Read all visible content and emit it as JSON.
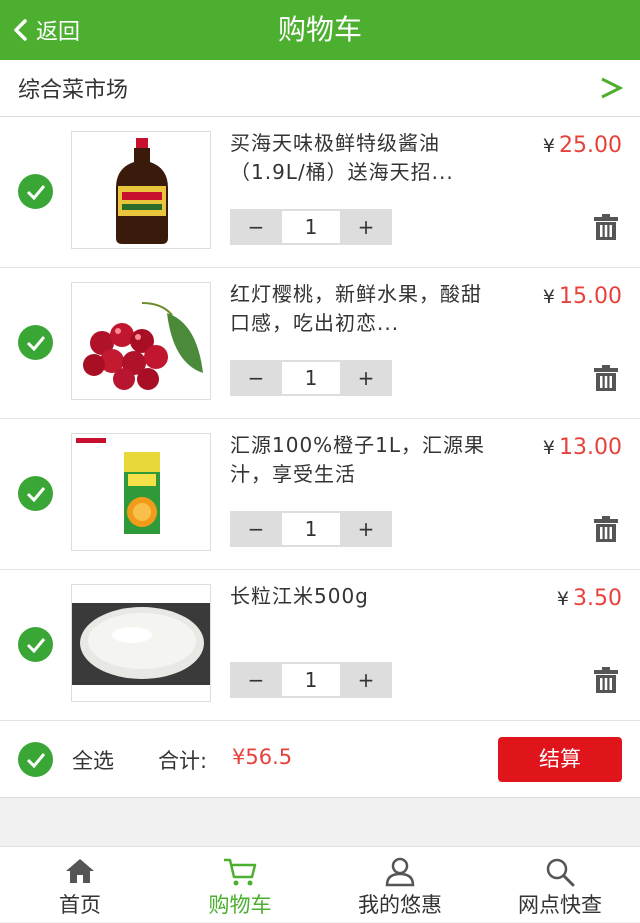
{
  "header": {
    "back_label": "返回",
    "title": "购物车"
  },
  "store": {
    "name": "综合菜市场"
  },
  "items": [
    {
      "name": "买海天味极鲜特级酱油（1.9L/桶）送海天招...",
      "currency": "¥",
      "price": "25.00",
      "quantity": "1",
      "image": "soy-sauce"
    },
    {
      "name": "红灯樱桃，新鲜水果，酸甜口感，吃出初恋...",
      "currency": "¥",
      "price": "15.00",
      "quantity": "1",
      "image": "cherries"
    },
    {
      "name": "汇源100%橙子1L，汇源果汁，享受生活",
      "currency": "¥",
      "price": "13.00",
      "quantity": "1",
      "image": "orange-juice"
    },
    {
      "name": "长粒江米500g",
      "currency": "¥",
      "price": "3.50",
      "quantity": "1",
      "image": "rice"
    }
  ],
  "stepper": {
    "minus": "−",
    "plus": "+"
  },
  "footer": {
    "select_all": "全选",
    "total_label": "合计:",
    "total_value": "¥56.5",
    "checkout": "结算"
  },
  "tabs": [
    {
      "label": "首页",
      "icon": "home-icon",
      "active": false
    },
    {
      "label": "购物车",
      "icon": "cart-icon",
      "active": true
    },
    {
      "label": "我的悠惠",
      "icon": "user-icon",
      "active": false
    },
    {
      "label": "网点快查",
      "icon": "search-icon",
      "active": false
    }
  ],
  "colors": {
    "brand_green": "#4caf2f",
    "check_green": "#3aa635",
    "price_red": "#e8413b",
    "checkout_red": "#e0141b"
  }
}
